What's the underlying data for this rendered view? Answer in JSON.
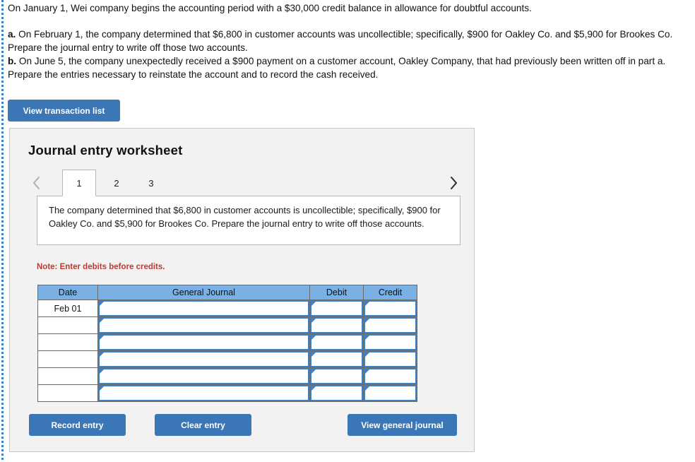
{
  "problem": {
    "intro": "On January 1, Wei company begins the accounting period with a $30,000 credit balance in allowance for doubtful accounts.",
    "part_a_label": "a.",
    "part_a_text": " On February 1, the company determined that $6,800 in customer accounts was uncollectible; specifically, $900 for Oakley Co. and $5,900 for Brookes Co. Prepare the journal entry to write off those two accounts.",
    "part_b_label": "b.",
    "part_b_text": " On June 5, the company unexpectedly received a $900 payment on a customer account, Oakley Company, that had previously been written off in part a. Prepare the entries necessary to reinstate the account and to record the cash received."
  },
  "toolbar": {
    "view_transaction_list": "View transaction list"
  },
  "worksheet": {
    "title": "Journal entry worksheet",
    "prev_icon": "chevron-left-icon",
    "next_icon": "chevron-right-icon",
    "tabs": [
      {
        "label": "1",
        "active": true
      },
      {
        "label": "2",
        "active": false
      },
      {
        "label": "3",
        "active": false
      }
    ],
    "description": "The company determined that $6,800 in customer accounts is uncollectible; specifically, $900 for Oakley Co. and $5,900 for Brookes Co. Prepare the journal entry to write off those accounts.",
    "note": "Note: Enter debits before credits."
  },
  "table": {
    "headers": [
      "Date",
      "General Journal",
      "Debit",
      "Credit"
    ],
    "rows": [
      {
        "date": "Feb 01",
        "general_journal": "",
        "debit": "",
        "credit": ""
      },
      {
        "date": "",
        "general_journal": "",
        "debit": "",
        "credit": ""
      },
      {
        "date": "",
        "general_journal": "",
        "debit": "",
        "credit": ""
      },
      {
        "date": "",
        "general_journal": "",
        "debit": "",
        "credit": ""
      },
      {
        "date": "",
        "general_journal": "",
        "debit": "",
        "credit": ""
      },
      {
        "date": "",
        "general_journal": "",
        "debit": "",
        "credit": ""
      }
    ]
  },
  "footer": {
    "record_entry": "Record entry",
    "clear_entry": "Clear entry",
    "view_general_journal": "View general journal"
  },
  "colors": {
    "button_blue": "#3b77b6",
    "header_blue": "#7bb0e5",
    "cell_border_blue": "#3f7fc4",
    "note_red": "#c2392e",
    "panel_bg": "#f2f2f2"
  }
}
